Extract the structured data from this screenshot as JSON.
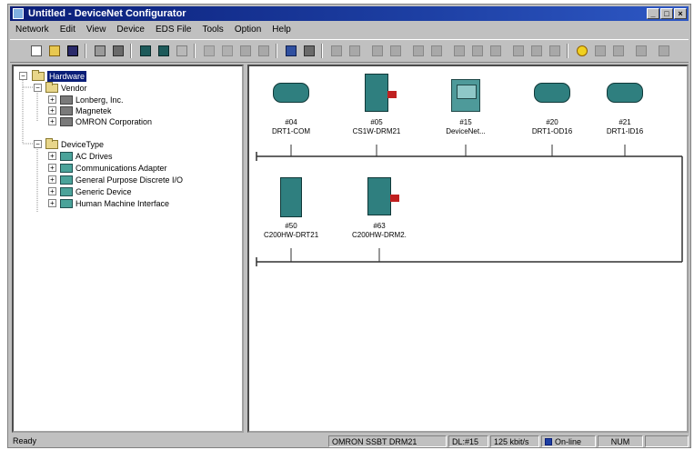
{
  "window": {
    "title": "Untitled - DeviceNet Configurator"
  },
  "menu": [
    "Network",
    "Edit",
    "View",
    "Device",
    "EDS File",
    "Tools",
    "Option",
    "Help"
  ],
  "tree": {
    "root": "Hardware",
    "groups": [
      {
        "label": "Vendor",
        "children": [
          "Lonberg, Inc.",
          "Magnetek",
          "OMRON Corporation"
        ]
      },
      {
        "label": "DeviceType",
        "children": [
          "AC Drives",
          "Communications Adapter",
          "General Purpose Discrete I/O",
          "Generic Device",
          "Human Machine Interface"
        ]
      }
    ]
  },
  "network": {
    "row1": [
      {
        "addr": "#04",
        "name": "DRT1-COM",
        "icon": "io-module-icon"
      },
      {
        "addr": "#05",
        "name": "CS1W-DRM21",
        "icon": "plc-unit-icon"
      },
      {
        "addr": "#15",
        "name": "DeviceNet...",
        "icon": "terminal-icon"
      },
      {
        "addr": "#20",
        "name": "DRT1-OD16",
        "icon": "io-module-icon"
      },
      {
        "addr": "#21",
        "name": "DRT1-ID16",
        "icon": "io-module-icon"
      }
    ],
    "row2": [
      {
        "addr": "#50",
        "name": "C200HW-DRT21",
        "icon": "slave-unit-icon"
      },
      {
        "addr": "#63",
        "name": "C200HW-DRM2...",
        "icon": "plc-unit-icon"
      }
    ]
  },
  "status": {
    "left": "Ready",
    "unit": "OMRON SSBT DRM21",
    "addr": "DL:#15",
    "baud": "125 kbit/s",
    "mode": "On-line",
    "num": "NUM"
  }
}
